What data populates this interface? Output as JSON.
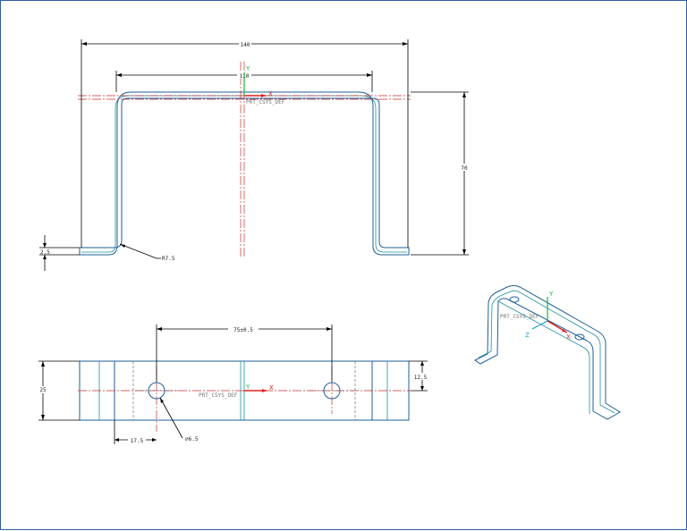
{
  "colors": {
    "part_edge": "#1f5f9a",
    "centerline": "#c03030",
    "axis_x": "#e02020",
    "axis_y": "#20b040",
    "axis_z": "#20a0c0",
    "border": "#2f5fa0"
  },
  "front_view": {
    "dim_overall_width": "140",
    "dim_inner_width": "110",
    "dim_height": "70",
    "dim_thickness": "2.5",
    "dim_radius": "R7.5",
    "csys_label": "PRT_CSYS_DEF",
    "axis_x": "X",
    "axis_y": "Y"
  },
  "top_view": {
    "dim_hole_spacing": "75±0.5",
    "dim_width": "25",
    "dim_half_width": "12.5",
    "dim_edge_offset": "17.5",
    "dim_hole_dia": "⌀6.5",
    "csys_label": "PRT_CSYS_DEF",
    "axis_x": "X",
    "axis_y": "Y"
  },
  "iso_view": {
    "csys_label": "PRT_CSYS_DEF",
    "axis_x": "X",
    "axis_y": "Y",
    "axis_z": "Z"
  }
}
